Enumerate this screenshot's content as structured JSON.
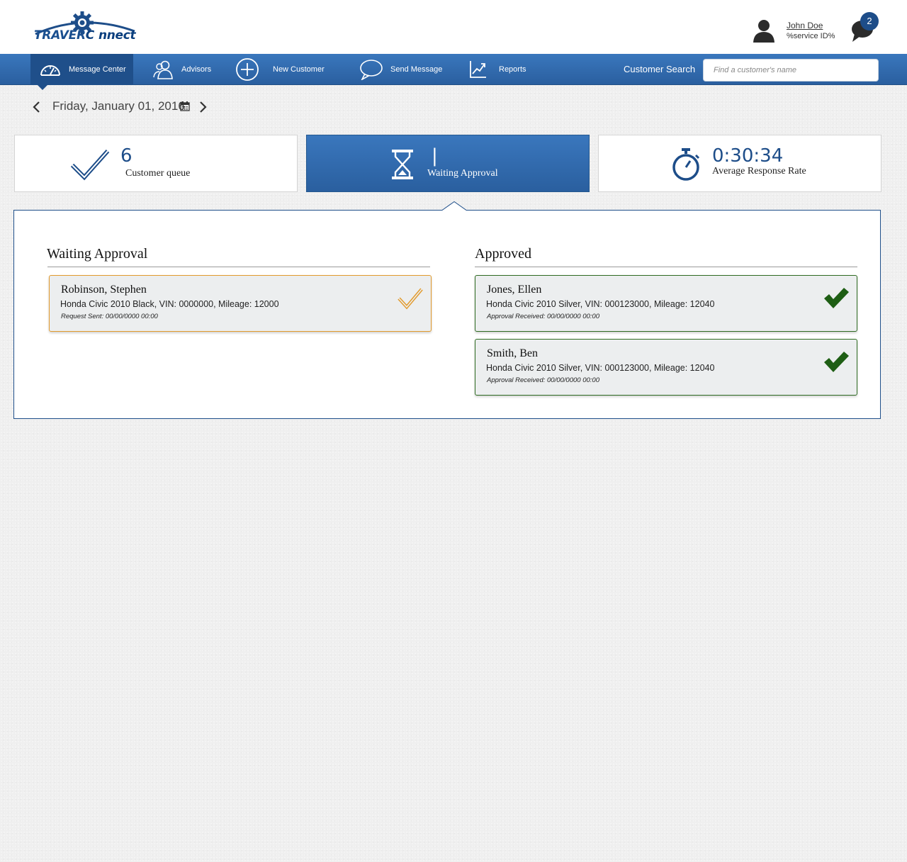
{
  "brand": {
    "logo_word_1": "TRAVER",
    "logo_word_2": "C",
    "logo_word_3": "nnect",
    "logo_icon": "gear-icon"
  },
  "user": {
    "name": "John Doe",
    "service_id": "%service ID%",
    "avatar_icon": "user-silhouette-icon",
    "chat_icon": "chat-bubble-icon",
    "notification_count": "2"
  },
  "nav": {
    "items": [
      {
        "label": "Message Center",
        "icon": "speedometer-icon",
        "active": true
      },
      {
        "label": "Advisors",
        "icon": "people-icon",
        "active": false
      },
      {
        "label": "New Customer",
        "icon": "plus-circle-icon",
        "active": false
      },
      {
        "label": "Send Message",
        "icon": "speech-bubble-icon",
        "active": false
      },
      {
        "label": "Reports",
        "icon": "line-chart-icon",
        "active": false
      }
    ],
    "search_label": "Customer Search",
    "search_placeholder": "Find a customer's name",
    "search_value": ""
  },
  "date": {
    "label": "Friday, January 01, 2016",
    "prev_icon": "chevron-left-icon",
    "next_icon": "chevron-right-icon",
    "calendar_icon": "calendar-icon"
  },
  "stats": [
    {
      "value": "6",
      "label": "Customer queue",
      "icon": "checkmark-icon",
      "active": false
    },
    {
      "value": "|",
      "label": "Waiting Approval",
      "icon": "hourglass-icon",
      "active": true
    },
    {
      "value": "0:30:34",
      "label": "Average Response Rate",
      "icon": "stopwatch-icon",
      "active": false
    }
  ],
  "waiting": {
    "title": "Waiting Approval",
    "items": [
      {
        "name": "Robinson, Stephen",
        "vehicle": "Honda Civic 2010 Black, VIN: 0000000, Mileage: 12000",
        "status": "Request Sent: 00/00/0000 00:00"
      }
    ]
  },
  "approved": {
    "title": "Approved",
    "items": [
      {
        "name": "Jones, Ellen",
        "vehicle": "Honda Civic 2010 Silver, VIN: 000123000, Mileage: 12040",
        "status": "Approval Received: 00/00/0000 00:00"
      },
      {
        "name": "Smith, Ben",
        "vehicle": "Honda Civic 2010 Silver, VIN: 000123000, Mileage: 12040",
        "status": "Approval Received: 00/00/0000 00:00"
      }
    ]
  },
  "colors": {
    "brand_blue": "#1d4d89",
    "nav_blue": "#3a77bd",
    "pending_orange": "#e29a2c",
    "approved_green": "#1e5e14"
  }
}
